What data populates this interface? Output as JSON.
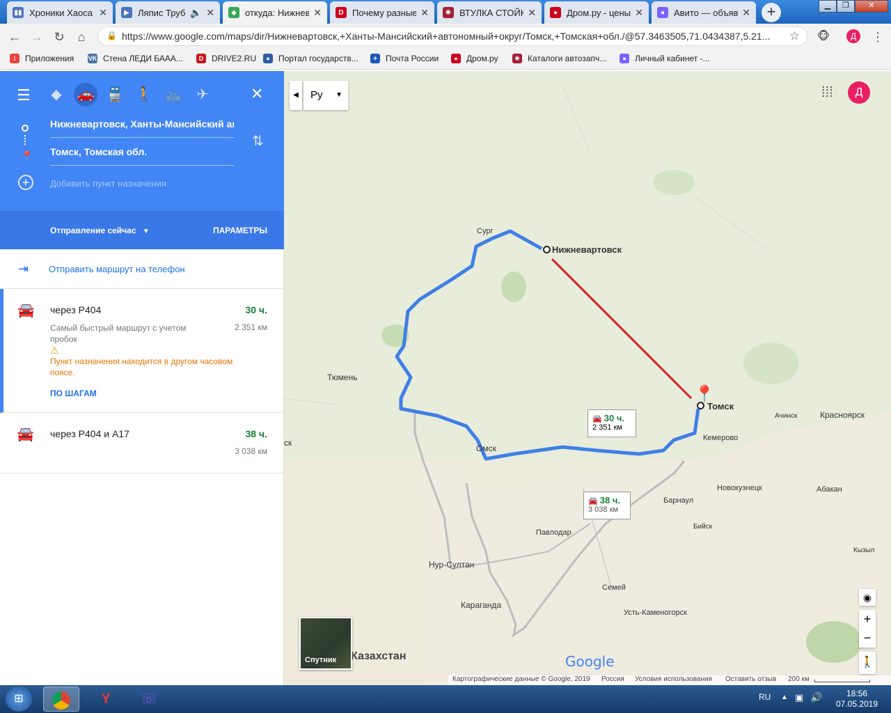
{
  "tabs": [
    {
      "title": "Хроники Хаоса",
      "color": "#4d73bf",
      "glyph": "▮▮"
    },
    {
      "title": "Ляпис Трубе",
      "color": "#4d73bf",
      "glyph": "▶"
    },
    {
      "title": "откуда: Нижнев",
      "color": "#34a853",
      "glyph": "◆"
    },
    {
      "title": "Почему разные",
      "color": "#d0021b",
      "glyph": "D"
    },
    {
      "title": "ВТУЛКА СТОЙКИ",
      "color": "#a31f34",
      "glyph": "✺"
    },
    {
      "title": "Дром.ру - цены",
      "color": "#d0021b",
      "glyph": "●"
    },
    {
      "title": "Авито — объяв",
      "color": "#7b61ff",
      "glyph": "●"
    }
  ],
  "new_tab": "+",
  "address": "https://www.google.com/maps/dir/Нижневартовск,+Ханты-Мансийский+автономный+округ/Томск,+Томская+обл./@57.3463505,71.0434387,5.21...",
  "bookmarks": [
    {
      "label": "Приложения",
      "color": "#e8453c",
      "glyph": "⁞"
    },
    {
      "label": "Стена ЛЕДИ БААА...",
      "color": "#4a76a8",
      "glyph": "VK"
    },
    {
      "label": "DRIVE2.RU",
      "color": "#c4161c",
      "glyph": "D"
    },
    {
      "label": "Портал государств...",
      "color": "#2e5aa8",
      "glyph": "●"
    },
    {
      "label": "Почта России",
      "color": "#1a56b4",
      "glyph": "✈"
    },
    {
      "label": "Дром.ру",
      "color": "#d0021b",
      "glyph": "●"
    },
    {
      "label": "Каталоги автозапч...",
      "color": "#a31f34",
      "glyph": "✺"
    },
    {
      "label": "Личный кабинет -...",
      "color": "#7b61ff",
      "glyph": "●"
    }
  ],
  "directions": {
    "origin": "Нижневартовск, Ханты-Мансийский автономный округ",
    "destination": "Томск, Томская обл.",
    "add_destination": "Добавить пункт назначения",
    "departure": "Отправление сейчас",
    "options": "ПАРАМЕТРЫ",
    "send_to_phone": "Отправить маршрут на телефон"
  },
  "routes": [
    {
      "via": "через Р404",
      "time": "30 ч.",
      "distance": "2 351 км",
      "note": "Самый быстрый маршрут с учетом пробок",
      "warning": "Пункт назначения находится в другом часовом поясе.",
      "steps": "ПО ШАГАМ"
    },
    {
      "via": "через Р404 и А17",
      "time": "38 ч.",
      "distance": "3 038 км"
    }
  ],
  "map": {
    "language": "Ру",
    "avatar": "Д",
    "cities": {
      "nizhnevartovsk": "Нижневартовск",
      "tomsk": "Томск",
      "surgut": "Сург",
      "tyumen": "Тюмень",
      "omsk": "Омск",
      "kemerovo": "Кемерово",
      "novokuznetsk": "Новокузнецк",
      "barnaul": "Барнаул",
      "biysk": "Бийск",
      "achinsk": "Ачинск",
      "krasnoyarsk": "Красноярск",
      "abakan": "Абакан",
      "kyzyl": "Кызыл",
      "pavlodar": "Павлодар",
      "nur_sultan": "Нур-Султан",
      "karaganda": "Караганда",
      "semey": "Семей",
      "ust_kamenogorsk": "Усть-Каменогорск",
      "kazakhstan": "Казахстан",
      "kurgan_partial": "ск"
    },
    "bubble1": {
      "time": "30 ч.",
      "distance": "2 351 км"
    },
    "bubble2": {
      "time": "38 ч.",
      "distance": "3 038 км"
    },
    "satellite": "Спутник",
    "google": "Google",
    "footer": {
      "data": "Картографические данные © Google, 2019",
      "country": "Россия",
      "terms": "Условия использования",
      "feedback": "Оставить отзыв",
      "scale": "200 км"
    },
    "zoom_in": "+",
    "zoom_out": "−"
  },
  "taskbar": {
    "lang": "RU",
    "time": "18:56",
    "date": "07.05.2019"
  }
}
